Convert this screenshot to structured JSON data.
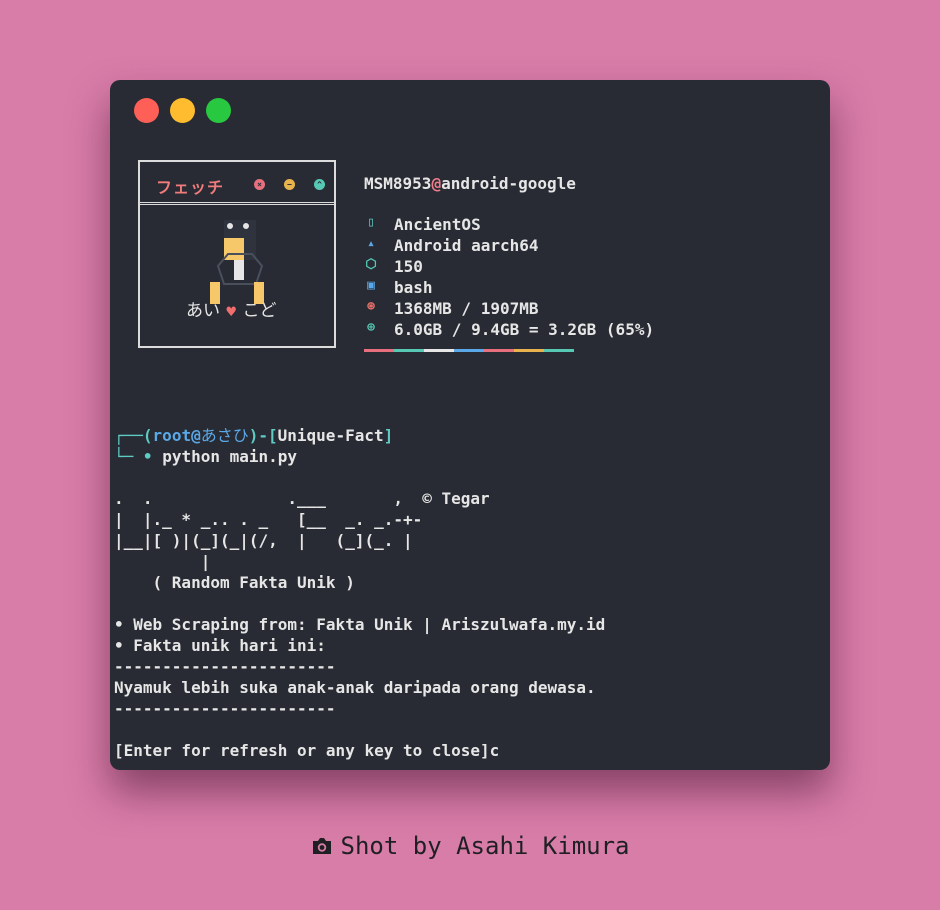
{
  "window": {
    "controls": [
      "close",
      "minimize",
      "maximize"
    ]
  },
  "fetch": {
    "box_title": "フェッチ",
    "label_left": "あい",
    "label_heart": "♥",
    "label_right": "こど",
    "host_user": "MSM8953",
    "host_at": "@",
    "host_name": "android-google",
    "rows": [
      {
        "icon": "phone-icon",
        "glyph": "▯",
        "color": "#5ecbc4",
        "value": "AncientOS"
      },
      {
        "icon": "android-icon",
        "glyph": "▴",
        "color": "#5aa8e8",
        "value": "Android aarch64"
      },
      {
        "icon": "package-icon",
        "glyph": "⬡",
        "color": "#56c8b3",
        "value": "150"
      },
      {
        "icon": "terminal-icon",
        "glyph": "▣",
        "color": "#5aa8e8",
        "value": "bash"
      },
      {
        "icon": "memory-icon",
        "glyph": "⊛",
        "color": "#e8706a",
        "value": "1368MB / 1907MB"
      },
      {
        "icon": "disk-icon",
        "glyph": "⊕",
        "color": "#56c8b3",
        "value": "6.0GB / 9.4GB = 3.2GB (65%)"
      }
    ],
    "palette": [
      "#e8707e",
      "#56c8b3",
      "#e6e6e6",
      "#5aa8e8",
      "#e8707e",
      "#e8b34e",
      "#56c8b3"
    ]
  },
  "prompt": {
    "corner_top": "┌──",
    "open_paren": "(",
    "user": "root",
    "at": "@",
    "host": "あさひ",
    "close_sep": ")-[",
    "dir": "Unique-Fact",
    "close_bracket": "]",
    "corner_bottom": "└─",
    "bullet": "•",
    "command": "python main.py"
  },
  "banner": {
    "lines": [
      ".  .              .___       ,  © Tegar",
      "|  |._ * _.. . _   [__  _. _.-+-",
      "|__|[ )|(_](_|(/,  |   (_](_. |",
      "         |",
      "    ( Random Fakta Unik )"
    ]
  },
  "output": {
    "source_line": "• Web Scraping from: Fakta Unik | Ariszulwafa.my.id",
    "today_line": "• Fakta unik hari ini:",
    "divider": "-----------------------",
    "fact": "Nyamuk lebih suka anak-anak daripada orang dewasa.",
    "divider2": "-----------------------",
    "prompt_close": "[Enter for refresh or any key to close]c"
  },
  "footer": {
    "icon": "camera-icon",
    "text": "Shot by Asahi Kimura"
  }
}
